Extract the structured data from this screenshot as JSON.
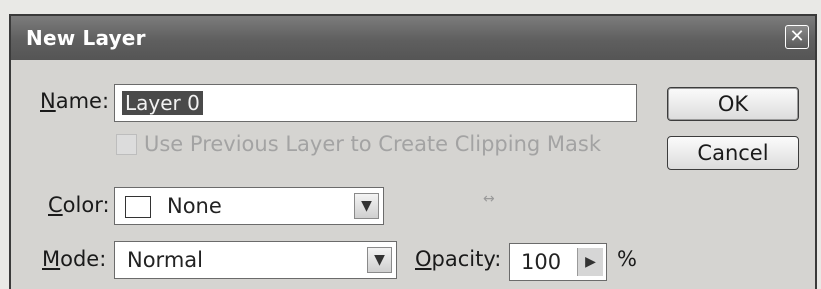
{
  "dialog": {
    "title": "New Layer",
    "close_glyph": "✕"
  },
  "name_field": {
    "label": "Name:",
    "value": "Layer 0"
  },
  "buttons": {
    "ok": "OK",
    "cancel": "Cancel"
  },
  "clipping_mask": {
    "label": "Use Previous Layer to Create Clipping Mask",
    "checked": false,
    "enabled": false
  },
  "color_field": {
    "label": "Color:",
    "value": "None",
    "swatch_color": "#ffffff"
  },
  "mode_field": {
    "label": "Mode:",
    "value": "Normal"
  },
  "opacity_field": {
    "label": "Opacity:",
    "value": "100",
    "unit": "%"
  },
  "icons": {
    "dropdown_arrow": "chevron-down-icon",
    "opacity_stepper": "triangle-right-icon"
  }
}
